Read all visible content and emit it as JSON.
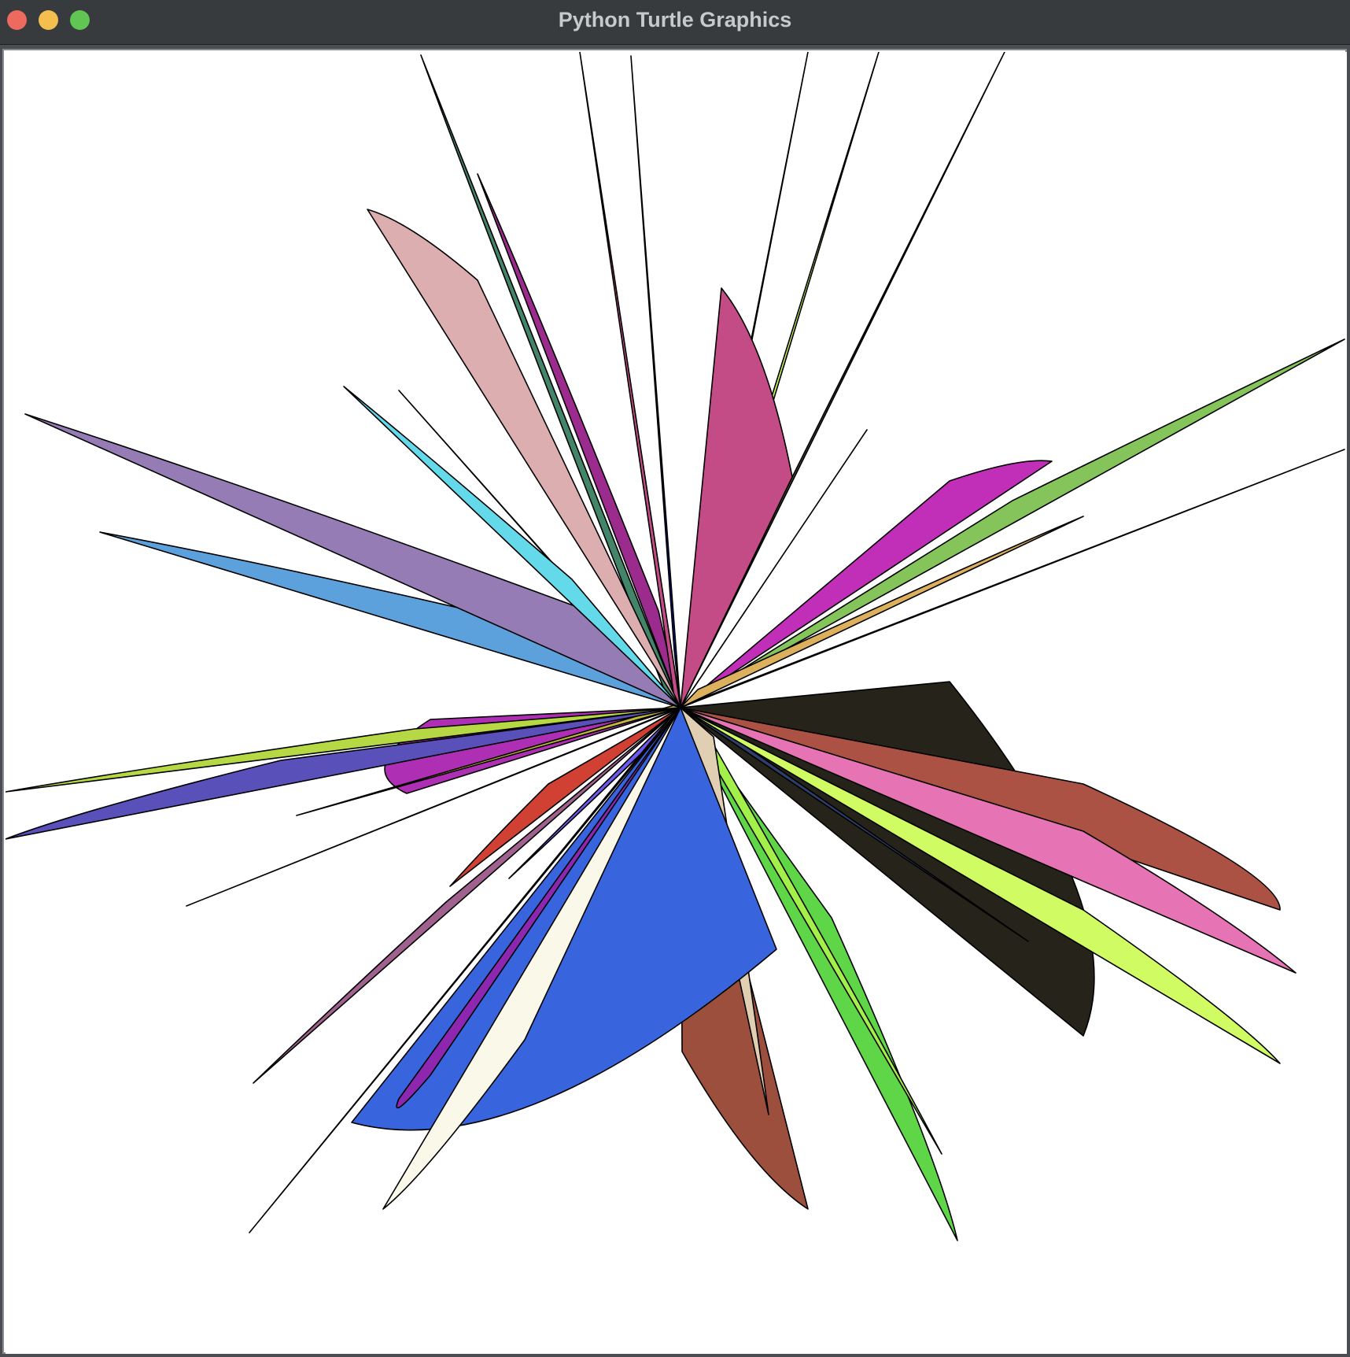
{
  "window": {
    "title": "Python Turtle Graphics",
    "buttons": [
      {
        "name": "close",
        "color": "#ed6a5e"
      },
      {
        "name": "minimize",
        "color": "#f4bf4f"
      },
      {
        "name": "zoom",
        "color": "#61c554"
      }
    ]
  },
  "canvas": {
    "background": "#ffffff",
    "stroke": "#000000",
    "petal_colors": [
      "#438569",
      "#9b2b8c",
      "#c34b86",
      "#0716a0",
      "#563c9f",
      "#c6f255",
      "#4a473c",
      "#ccdf4c",
      "#85c45a",
      "#c12eb8",
      "#dcb05c",
      "#1e2120",
      "#26231b",
      "#2e3f6b",
      "#ab5245",
      "#e673b4",
      "#d1fb62",
      "#5fd648",
      "#a3f04a",
      "#9c4f3c",
      "#e0cfb2",
      "#3865de",
      "#6f59ee",
      "#c5d1cc",
      "#faf8e8",
      "#8d27b0",
      "#c0b93a",
      "#a7797c",
      "#b6d845",
      "#5950ba",
      "#ae2fb3",
      "#5da1dc",
      "#967cb4",
      "#c25676",
      "#63d9e9",
      "#d04134",
      "#a0618e",
      "#dcaeb0"
    ]
  }
}
